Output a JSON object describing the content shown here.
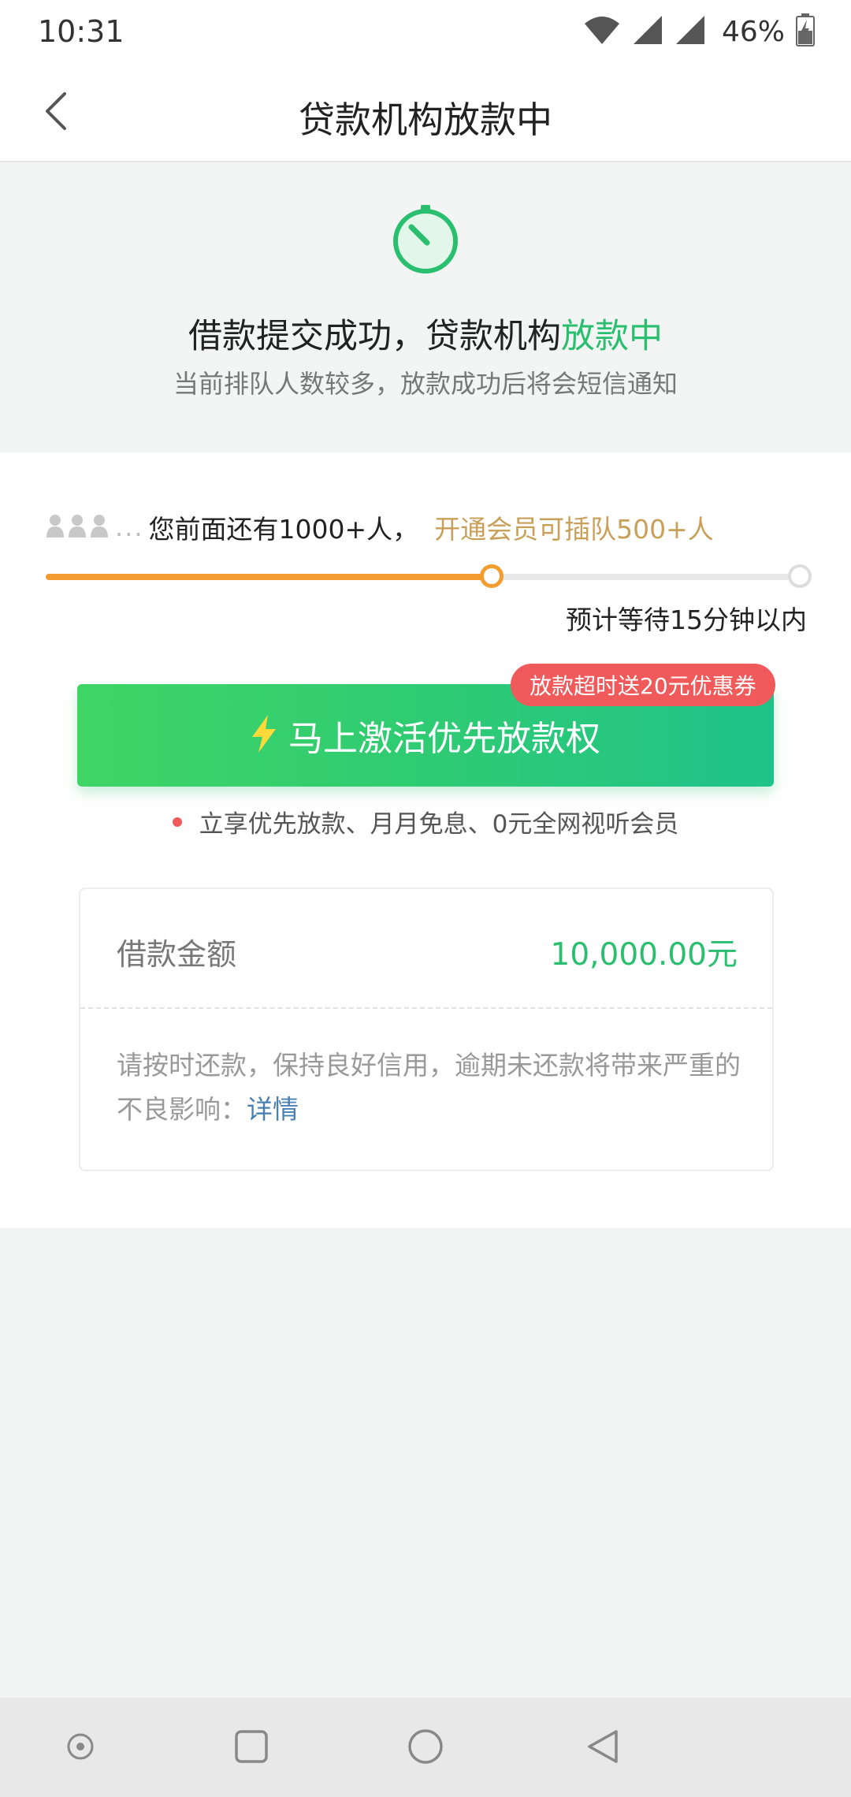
{
  "status_bar": {
    "time": "10:31",
    "battery": "46%",
    "icons": [
      "wifi-icon",
      "signal-icon",
      "signal-icon",
      "battery-charging-icon"
    ]
  },
  "header": {
    "title": "贷款机构放款中",
    "back_icon": "chevron-left-icon"
  },
  "banner": {
    "icon": "timer-icon",
    "title_prefix": "借款提交成功，贷款机构",
    "title_highlight": "放款中",
    "subtitle": "当前排队人数较多，放款成功后将会短信通知"
  },
  "queue": {
    "dots": "...",
    "text": "您前面还有1000+人，",
    "promo": "开通会员可插队500+人",
    "progress": 0.59,
    "wait": "预计等待15分钟以内"
  },
  "activate": {
    "label": "马上激活优先放款权",
    "badge": "放款超时送20元优惠券",
    "benefits": "立享优先放款、月月免息、0元全网视听会员"
  },
  "loan": {
    "label": "借款金额",
    "amount": "10,000.00元",
    "note": "请按时还款，保持良好信用，逾期未还款将带来严重的不良影响：",
    "detail_link": "详情"
  },
  "colors": {
    "accent_green": "#29bf6e",
    "progress_orange": "#f39c2f",
    "promo_gold": "#c9a05a",
    "badge_red": "#f05a5b",
    "link_blue": "#4a7fb3"
  }
}
